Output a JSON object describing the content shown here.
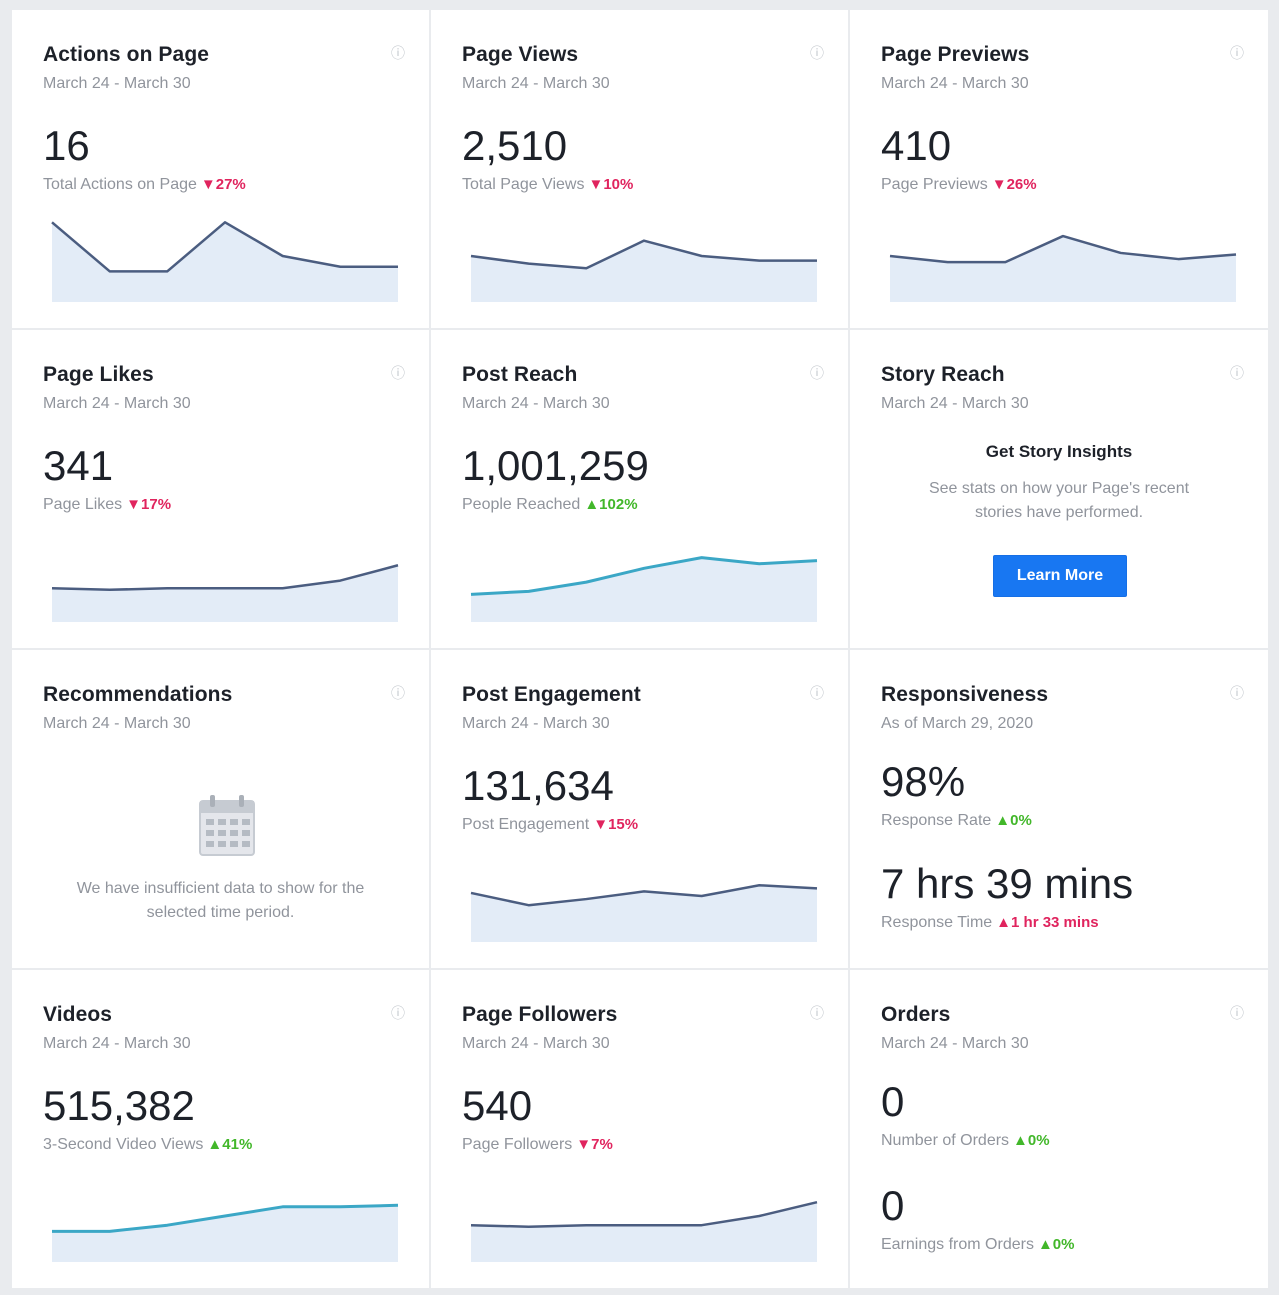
{
  "colors": {
    "line": "#4b5d80",
    "line_video": "#3ba7c6",
    "area": "#e3ecf7",
    "down": "#e0245e",
    "up": "#42b72a",
    "button": "#1877f2"
  },
  "icons": {
    "info": "info-icon",
    "calendar": "calendar-icon",
    "arrow_down": "▼",
    "arrow_up": "▲"
  },
  "cards": {
    "actions": {
      "title": "Actions on Page",
      "date": "March 24 - March 30",
      "value": "16",
      "label": "Total Actions on Page",
      "delta": "27%",
      "trend": [
        52,
        20,
        20,
        52,
        30,
        23,
        23
      ]
    },
    "views": {
      "title": "Page Views",
      "date": "March 24 - March 30",
      "value": "2,510",
      "label": "Total Page Views",
      "delta": "10%",
      "trend": [
        30,
        25,
        22,
        40,
        30,
        27,
        27
      ]
    },
    "previews": {
      "title": "Page Previews",
      "date": "March 24 - March 30",
      "value": "410",
      "label": "Page Previews",
      "delta": "26%",
      "trend": [
        30,
        26,
        26,
        43,
        32,
        28,
        31
      ]
    },
    "likes": {
      "title": "Page Likes",
      "date": "March 24 - March 30",
      "value": "341",
      "label": "Page Likes",
      "delta": "17%",
      "trend": [
        22,
        21,
        22,
        22,
        22,
        27,
        37
      ]
    },
    "reach": {
      "title": "Post Reach",
      "date": "March 24 - March 30",
      "value": "1,001,259",
      "label": "People Reached",
      "delta": "102%",
      "trend": [
        18,
        20,
        26,
        35,
        42,
        38,
        40
      ]
    },
    "story": {
      "title": "Story Reach",
      "date": "March 24 - March 30",
      "heading": "Get Story Insights",
      "body_line1": "See stats on how your Page's recent",
      "body_line2": "stories have performed.",
      "button": "Learn More"
    },
    "recommendations": {
      "title": "Recommendations",
      "date": "March 24 - March 30",
      "message_line1": "We have insufficient data to show for the",
      "message_line2": "selected time period."
    },
    "engagement": {
      "title": "Post Engagement",
      "date": "March 24 - March 30",
      "value": "131,634",
      "label": "Post Engagement",
      "delta": "15%",
      "trend": [
        32,
        24,
        28,
        33,
        30,
        37,
        35
      ]
    },
    "responsiveness": {
      "title": "Responsiveness",
      "date": "As of March 29, 2020",
      "value": "98%",
      "label": "Response Rate",
      "delta": "0%",
      "value2": "7 hrs 39 mins",
      "label2": "Response Time",
      "delta2": "1 hr 33 mins"
    },
    "videos": {
      "title": "Videos",
      "date": "March 24 - March 30",
      "value": "515,382",
      "label": "3-Second Video Views",
      "delta": "41%",
      "trend": [
        20,
        20,
        24,
        30,
        36,
        36,
        37
      ]
    },
    "followers": {
      "title": "Page Followers",
      "date": "March 24 - March 30",
      "value": "540",
      "label": "Page Followers",
      "delta": "7%",
      "trend": [
        24,
        23,
        24,
        24,
        24,
        30,
        39
      ]
    },
    "orders": {
      "title": "Orders",
      "date": "March 24 - March 30",
      "value": "0",
      "label": "Number of Orders",
      "delta": "0%",
      "value2": "0",
      "label2": "Earnings from Orders",
      "delta2": "0%"
    }
  }
}
